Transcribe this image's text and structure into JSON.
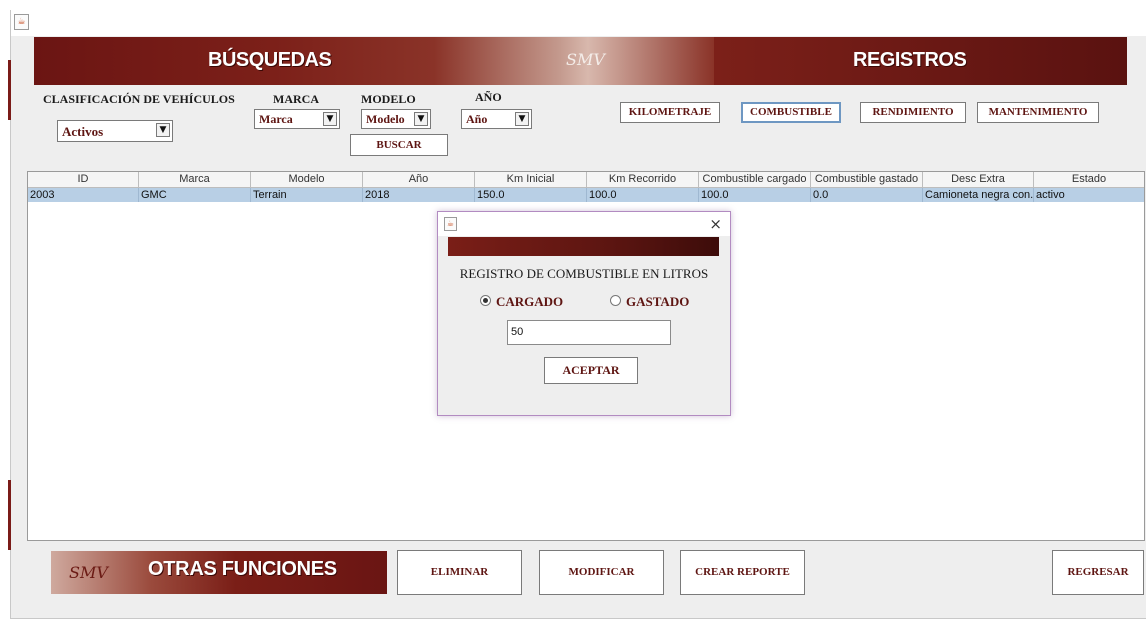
{
  "header": {
    "busquedas": "BÚSQUEDAS",
    "registros": "REGISTROS",
    "logo": "SMV"
  },
  "filters": {
    "clasificacion_label": "CLASIFICACIÓN DE VEHÍCULOS",
    "clasificacion_value": "Activos",
    "marca_label": "MARCA",
    "marca_value": "Marca",
    "modelo_label": "MODELO",
    "modelo_value": "Modelo",
    "anio_label": "AÑO",
    "anio_value": "Año",
    "buscar": "BUSCAR"
  },
  "register_buttons": [
    "KILOMETRAJE",
    "COMBUSTIBLE",
    "RENDIMIENTO",
    "MANTENIMIENTO"
  ],
  "table": {
    "columns": [
      "ID",
      "Marca",
      "Modelo",
      "Año",
      "Km Inicial",
      "Km Recorrido",
      "Combustible cargado",
      "Combustible gastado",
      "Desc Extra",
      "Estado"
    ],
    "rows": [
      [
        "2003",
        "GMC",
        "Terrain",
        "2018",
        "150.0",
        "100.0",
        "100.0",
        "0.0",
        "Camioneta negra con...",
        "activo"
      ]
    ]
  },
  "dialog": {
    "close": "×",
    "heading": "REGISTRO DE COMBUSTIBLE EN LITROS",
    "radio_cargado": "CARGADO",
    "radio_gastado": "GASTADO",
    "selected": "CARGADO",
    "input_value": "50",
    "accept": "ACEPTAR"
  },
  "footer": {
    "title": "OTRAS FUNCIONES",
    "logo": "SMV",
    "eliminar": "ELIMINAR",
    "modificar": "MODIFICAR",
    "crear_reporte": "CREAR REPORTE",
    "regresar": "REGRESAR"
  },
  "icons": {
    "window": "java-icon",
    "dropdown": "chevron-down-icon"
  },
  "colors": {
    "brand": "#7a1e17",
    "label": "#5e1512",
    "selection": "#b8cfe5"
  }
}
